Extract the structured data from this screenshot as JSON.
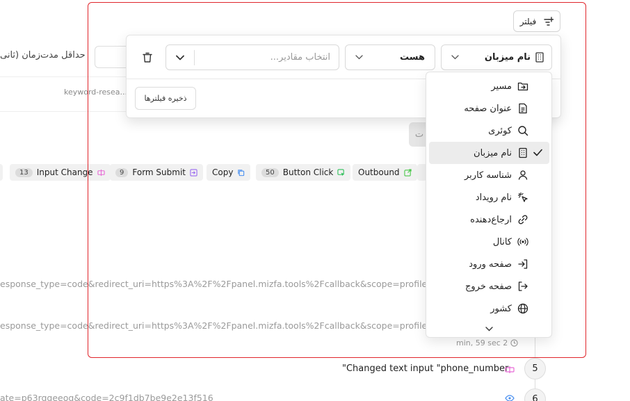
{
  "background": {
    "min_duration_label": "حداقل مدت‌زمان (ثانی",
    "search_hint": "keyword-resea...",
    "chips": [
      {
        "label": "Input Change",
        "count": "13",
        "color": "#e86ad6"
      },
      {
        "label": "Form Submit",
        "count": "9",
        "color": "#9b6bf0"
      },
      {
        "label": "Copy",
        "count": "",
        "color": "#4a90f0"
      },
      {
        "label": "Button Click",
        "count": "50",
        "color": "#2fbf5a"
      },
      {
        "label": "Outbound",
        "count": "",
        "color": "#4cc84c"
      }
    ],
    "url_row_1": "esponse_type=code&redirect_uri=https%3A%2F%2Fpanel.mizfa.tools%2Fcallback&scope=profile&st",
    "url_row_2": "esponse_type=code&redirect_uri=https%3A%2F%2Fpanel.mizfa.tools%2Fcallback&scope=profile&st",
    "event_time": "min, 59 sec 2",
    "event_5_text": "\"Changed text input \"phone_number",
    "event_5_index": "5",
    "event_6_text": "ate=p63rqgeeog&code=2c9f1db7be9e2e13f516",
    "event_6_index": "6",
    "gray_button_text": "ت"
  },
  "filter": {
    "button_label": "فیلتر",
    "field_select_value": "نام میزبان",
    "operator_select_value": "هست",
    "values_placeholder": "انتخاب مقادیر...",
    "save_label": "ذخیره فیلترها"
  },
  "dropdown": {
    "options": [
      {
        "label": "مسیر",
        "icon": "folder-arrow-icon",
        "selected": false
      },
      {
        "label": "عنوان صفحه",
        "icon": "document-icon",
        "selected": false
      },
      {
        "label": "کوئری",
        "icon": "search-icon",
        "selected": false
      },
      {
        "label": "نام میزبان",
        "icon": "building-icon",
        "selected": true
      },
      {
        "label": "شناسه کاربر",
        "icon": "user-icon",
        "selected": false
      },
      {
        "label": "نام رویداد",
        "icon": "cursor-click-icon",
        "selected": false
      },
      {
        "label": "ارجاع‌دهنده",
        "icon": "link-icon",
        "selected": false
      },
      {
        "label": "کانال",
        "icon": "broadcast-icon",
        "selected": false
      },
      {
        "label": "صفحه ورود",
        "icon": "login-icon",
        "selected": false
      },
      {
        "label": "صفحه خروج",
        "icon": "logout-icon",
        "selected": false
      },
      {
        "label": "کشور",
        "icon": "globe-icon",
        "selected": false
      }
    ]
  },
  "colors": {
    "highlight_frame": "#e0252b",
    "selected_option_bg": "#ececec"
  }
}
